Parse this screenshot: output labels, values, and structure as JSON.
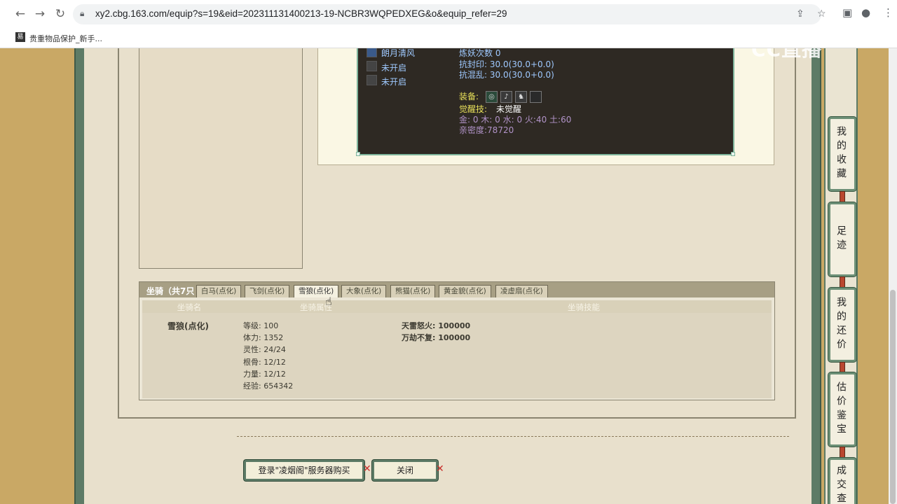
{
  "browser": {
    "url": "xy2.cbg.163.com/equip?s=19&eid=202311131400213-19-NCBR3WQPEDXEG&o&equip_refer=29",
    "bookmark": "贵重物品保护_新手..."
  },
  "watermark": "CC直播",
  "pet": {
    "skills": [
      "朗月清风",
      "未开启",
      "未开启"
    ],
    "lianyao": "炼妖次数 0",
    "kangfengyin": "抗封印: 30.0(30.0+0.0)",
    "kanghunluan": "抗混乱: 30.0(30.0+0.0)",
    "equip_label": "装备:",
    "juexing_label": "觉醒技:",
    "juexing_value": "未觉醒",
    "wuxing": "金: 0 木: 0 水: 0 火:40 土:60",
    "qinmi": "亲密度:78720"
  },
  "mount": {
    "title": "坐骑（共7只",
    "tabs": [
      "白马(点化)",
      "飞剑(点化)",
      "雪狼(点化)",
      "大象(点化)",
      "熊猫(点化)",
      "黄金貌(点化)",
      "凌虚扇(点化)"
    ],
    "active_tab": 2,
    "headers": [
      "坐骑名",
      "坐骑属性",
      "坐骑技能"
    ],
    "name": "雪狼(点化)",
    "attrs": [
      "等级: 100",
      "体力: 1352",
      "灵性: 24/24",
      "根骨: 12/12",
      "力量: 12/12",
      "经验: 654342"
    ],
    "skills": [
      "天雷怒火: 100000",
      "万劫不复: 100000"
    ]
  },
  "buttons": {
    "buy": "登录\"凌烟阁\"服务器购买",
    "close": "关闭"
  },
  "sidebar": [
    "我的收藏",
    "足迹",
    "我的还价",
    "估价鉴宝",
    "成交查"
  ]
}
